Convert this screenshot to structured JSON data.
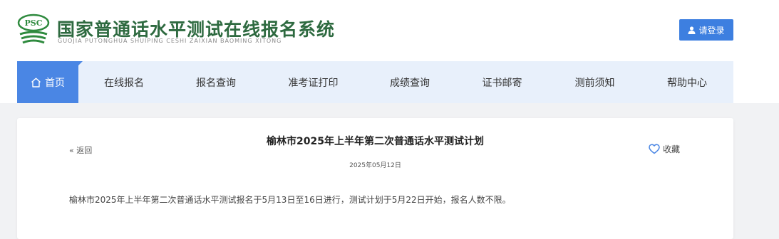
{
  "header": {
    "logo_text": "PSC",
    "title": "国家普通话水平测试在线报名系统",
    "pinyin": "GUOJIA PUTONGHUA SHUIPING CESHI ZAIXIAN BAOMING XITONG",
    "login_label": "请登录",
    "brand_color": "#2e6a40",
    "accent_color": "#3d7fe0"
  },
  "nav": {
    "items": [
      {
        "label": "首页",
        "active": true
      },
      {
        "label": "在线报名"
      },
      {
        "label": "报名查询"
      },
      {
        "label": "准考证打印"
      },
      {
        "label": "成绩查询"
      },
      {
        "label": "证书邮寄"
      },
      {
        "label": "测前须知"
      },
      {
        "label": "帮助中心"
      }
    ]
  },
  "article": {
    "back_label": "« 返回",
    "title": "榆林市2025年上半年第二次普通话水平测试计划",
    "date": "2025年05月12日",
    "favorite_label": "收藏",
    "body": "榆林市2025年上半年第二次普通话水平测试报名于5月13日至16日进行，测试计划于5月22日开始，报名人数不限。"
  }
}
